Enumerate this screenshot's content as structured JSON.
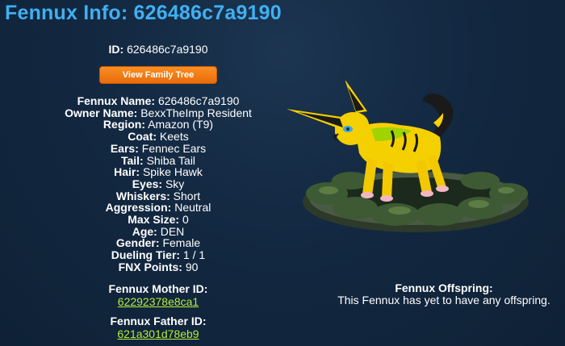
{
  "page": {
    "title": "Fennux Info: 626486c7a9190"
  },
  "id_line": {
    "label": "ID:",
    "value": "626486c7a9190"
  },
  "family_tree_button": "View Family Tree",
  "info": [
    {
      "label": "Fennux Name:",
      "value": "626486c7a9190"
    },
    {
      "label": "Owner Name:",
      "value": "BexxTheImp Resident"
    },
    {
      "label": "Region:",
      "value": "Amazon (T9)"
    },
    {
      "label": "Coat:",
      "value": "Keets"
    },
    {
      "label": "Ears:",
      "value": "Fennec Ears"
    },
    {
      "label": "Tail:",
      "value": "Shiba Tail"
    },
    {
      "label": "Hair:",
      "value": "Spike Hawk"
    },
    {
      "label": "Eyes:",
      "value": "Sky"
    },
    {
      "label": "Whiskers:",
      "value": "Short"
    },
    {
      "label": "Aggression:",
      "value": "Neutral"
    },
    {
      "label": "Max Size:",
      "value": "0"
    },
    {
      "label": "Age:",
      "value": "DEN"
    },
    {
      "label": "Gender:",
      "value": "Female"
    },
    {
      "label": "Dueling Tier:",
      "value": "1 / 1"
    },
    {
      "label": "FNX Points:",
      "value": "90"
    }
  ],
  "mother": {
    "label": "Fennux Mother ID:",
    "link": "62292378e8ca1"
  },
  "father": {
    "label": "Fennux Father ID:",
    "link": "621a301d78eb9"
  },
  "offspring": {
    "label": "Fennux Offspring:",
    "text": "This Fennux has yet to have any offspring."
  },
  "colors": {
    "title": "#3fb0f2",
    "button": "#f57f18",
    "link": "#b6ee3b",
    "background": "#132841"
  }
}
